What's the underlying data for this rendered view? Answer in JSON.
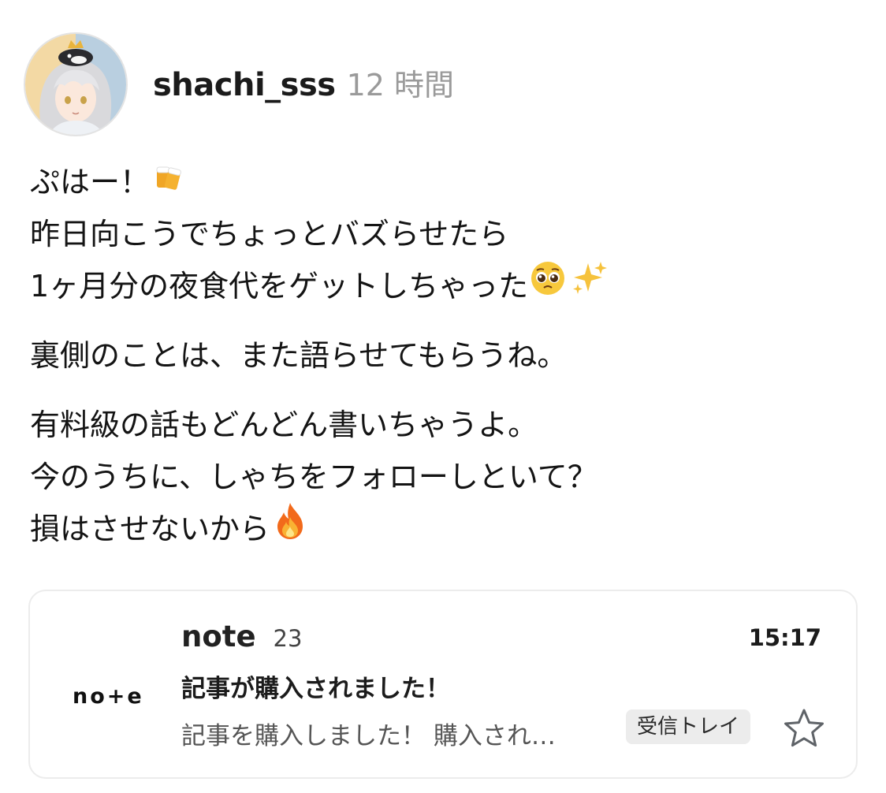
{
  "post": {
    "username": "shachi_sss",
    "timestamp": "12 時間",
    "paragraphs": [
      [
        "ぷはー！",
        "昨日向こうでちょっとバズらせたら",
        "1ヶ月分の夜食代をゲットしちゃった"
      ],
      [
        "裏側のことは、また語らせてもらうね。"
      ],
      [
        "有料級の話もどんどん書いちゃうよ。",
        "今のうちに、しゃちをフォローしといて？",
        "損はさせないから"
      ]
    ],
    "emojis": [
      "beer-mugs",
      "pleading-face",
      "sparkles",
      "fire"
    ]
  },
  "card": {
    "logo": "no+e",
    "sender": "note",
    "count": "23",
    "time": "15:17",
    "subject": "記事が購入されました！",
    "preview": "記事を購入しました！ 購入され…",
    "label": "受信トレイ",
    "star_icon": "star-outline"
  }
}
